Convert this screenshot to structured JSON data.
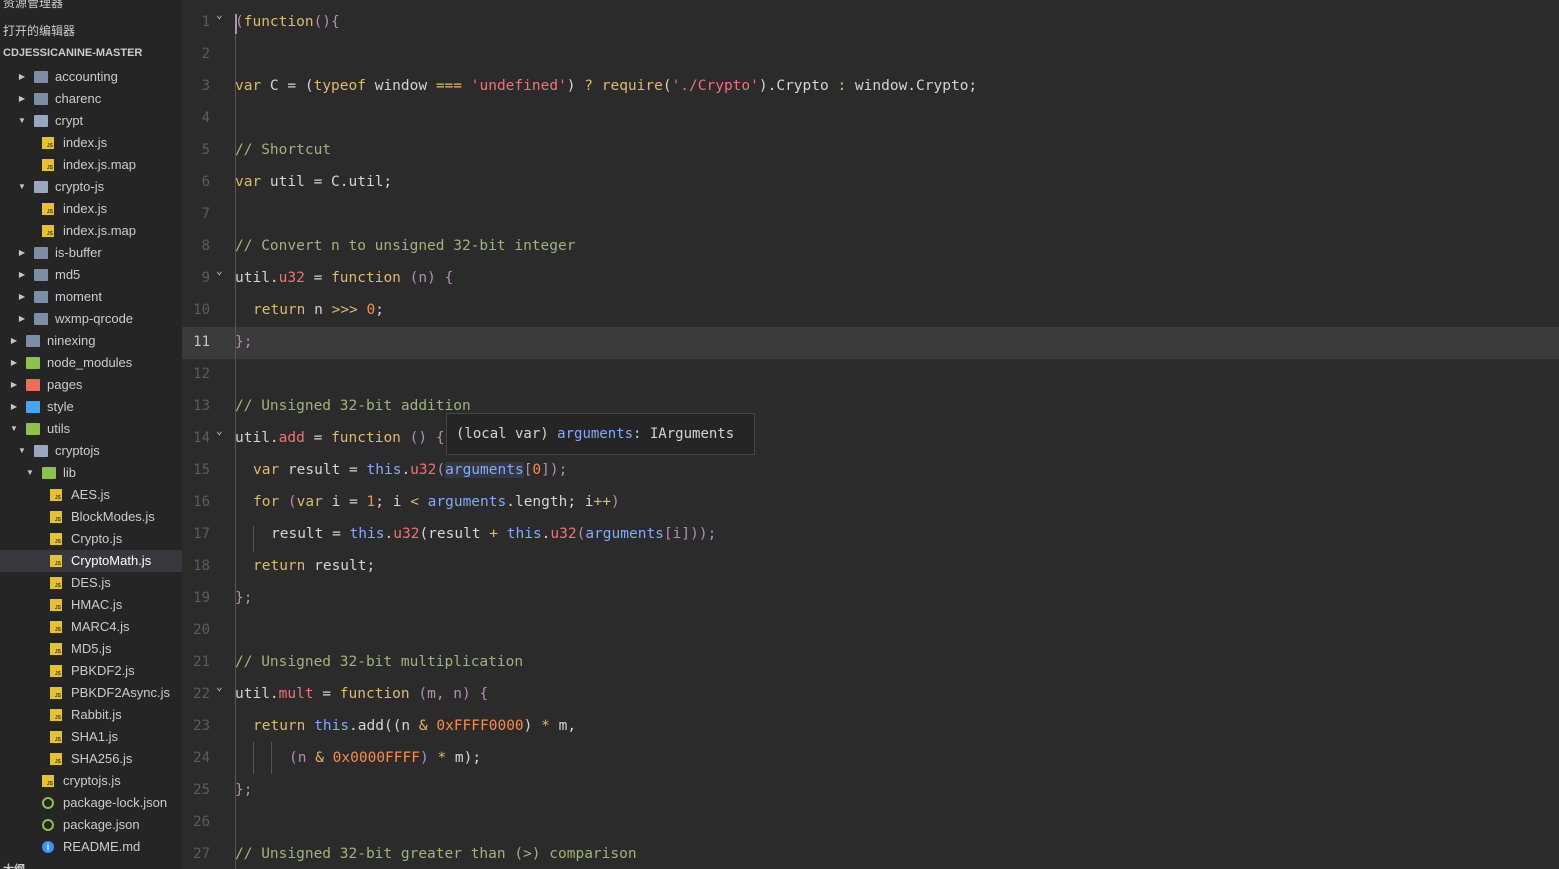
{
  "sidebar": {
    "title": "资源管理器",
    "more": "···",
    "open_editors": "打开的编辑器",
    "project": "CDJESSICANINE-MASTER",
    "bottom": "大纲",
    "items": [
      {
        "label": "accounting"
      },
      {
        "label": "charenc"
      },
      {
        "label": "crypt"
      },
      {
        "label": "index.js"
      },
      {
        "label": "index.js.map"
      },
      {
        "label": "crypto-js"
      },
      {
        "label": "index.js"
      },
      {
        "label": "index.js.map"
      },
      {
        "label": "is-buffer"
      },
      {
        "label": "md5"
      },
      {
        "label": "moment"
      },
      {
        "label": "wxmp-qrcode"
      },
      {
        "label": "ninexing"
      },
      {
        "label": "node_modules"
      },
      {
        "label": "pages"
      },
      {
        "label": "style"
      },
      {
        "label": "utils"
      },
      {
        "label": "cryptojs"
      },
      {
        "label": "lib"
      },
      {
        "label": "AES.js"
      },
      {
        "label": "BlockModes.js"
      },
      {
        "label": "Crypto.js"
      },
      {
        "label": "CryptoMath.js"
      },
      {
        "label": "DES.js"
      },
      {
        "label": "HMAC.js"
      },
      {
        "label": "MARC4.js"
      },
      {
        "label": "MD5.js"
      },
      {
        "label": "PBKDF2.js"
      },
      {
        "label": "PBKDF2Async.js"
      },
      {
        "label": "Rabbit.js"
      },
      {
        "label": "SHA1.js"
      },
      {
        "label": "SHA256.js"
      },
      {
        "label": "cryptojs.js"
      },
      {
        "label": "package-lock.json"
      },
      {
        "label": "package.json"
      },
      {
        "label": "README.md"
      }
    ]
  },
  "editor": {
    "current_line": "11",
    "line_numbers": [
      "1",
      "2",
      "3",
      "4",
      "5",
      "6",
      "7",
      "8",
      "9",
      "10",
      "11",
      "12",
      "13",
      "14",
      "15",
      "16",
      "17",
      "18",
      "19",
      "20",
      "21",
      "22",
      "23",
      "24",
      "25",
      "26",
      "27"
    ],
    "lines": {
      "l1": {
        "a": "(",
        "b": "function",
        "c": "(){"
      },
      "l3": {
        "a": "var",
        "b": " C = (",
        "c": "typeof",
        "d": " window ",
        "e": "===",
        "f": " ",
        "g": "'undefined'",
        "h": ") ",
        "i": "?",
        "j": " ",
        "k": "require",
        "l": "(",
        "m": "'./Crypto'",
        "n": ").Crypto ",
        "o": ":",
        "p": " window.Crypto;"
      },
      "l5": {
        "a": "// Shortcut"
      },
      "l6": {
        "a": "var",
        "b": " util = C.util;"
      },
      "l8": {
        "a": "// Convert n to unsigned 32-bit integer"
      },
      "l9": {
        "a": "util.",
        "b": "u32",
        "c": " = ",
        "d": "function",
        "e": " (",
        "f": "n",
        "g": ") {"
      },
      "l10": {
        "a": "return",
        "b": " n ",
        "c": ">>>",
        "d": " ",
        "e": "0",
        "f": ";"
      },
      "l11": {
        "a": "};"
      },
      "l13": {
        "a": "// Unsigned 32-bit addition"
      },
      "l14": {
        "a": "util.",
        "b": "add",
        "c": " = ",
        "d": "function",
        "e": " () {"
      },
      "l15": {
        "a": "var",
        "b": " result = ",
        "c": "this",
        "d": ".",
        "e": "u32",
        "f": "(",
        "g": "arguments",
        "h": "[",
        "i": "0",
        "j": "]);"
      },
      "l16": {
        "a": "for",
        "b": " (",
        "c": "var",
        "d": " i = ",
        "e": "1",
        "f": "; i ",
        "g": "<",
        "h": " ",
        "i": "arguments",
        "j": ".length; i",
        "k": "++",
        "l": ")"
      },
      "l17": {
        "a": "result = ",
        "b": "this",
        "c": ".",
        "d": "u32",
        "e": "(result ",
        "f": "+",
        "g": " ",
        "h": "this",
        "i": ".",
        "j": "u32",
        "k": "(",
        "l": "arguments",
        "m": "[i]));"
      },
      "l18": {
        "a": "return",
        "b": " result;"
      },
      "l19": {
        "a": "};"
      },
      "l21": {
        "a": "// Unsigned 32-bit multiplication"
      },
      "l22": {
        "a": "util.",
        "b": "mult",
        "c": " = ",
        "d": "function",
        "e": " (",
        "f": "m",
        "g": ", ",
        "h": "n",
        "i": ") {"
      },
      "l23": {
        "a": "return",
        "b": " ",
        "c": "this",
        "d": ".add((n ",
        "e": "&",
        "f": " ",
        "g": "0xFFFF0000",
        "h": ") ",
        "i": "*",
        "j": " m,"
      },
      "l24": {
        "a": "(n ",
        "b": "&",
        "c": " ",
        "d": "0x0000FFFF",
        "e": ") ",
        "f": "*",
        "g": " m);"
      },
      "l25": {
        "a": "};"
      },
      "l27": {
        "a": "// Unsigned 32-bit greater than (>) comparison"
      }
    }
  },
  "tooltip": {
    "prefix": "(local var) ",
    "name": "arguments",
    "type": ": IArguments"
  }
}
